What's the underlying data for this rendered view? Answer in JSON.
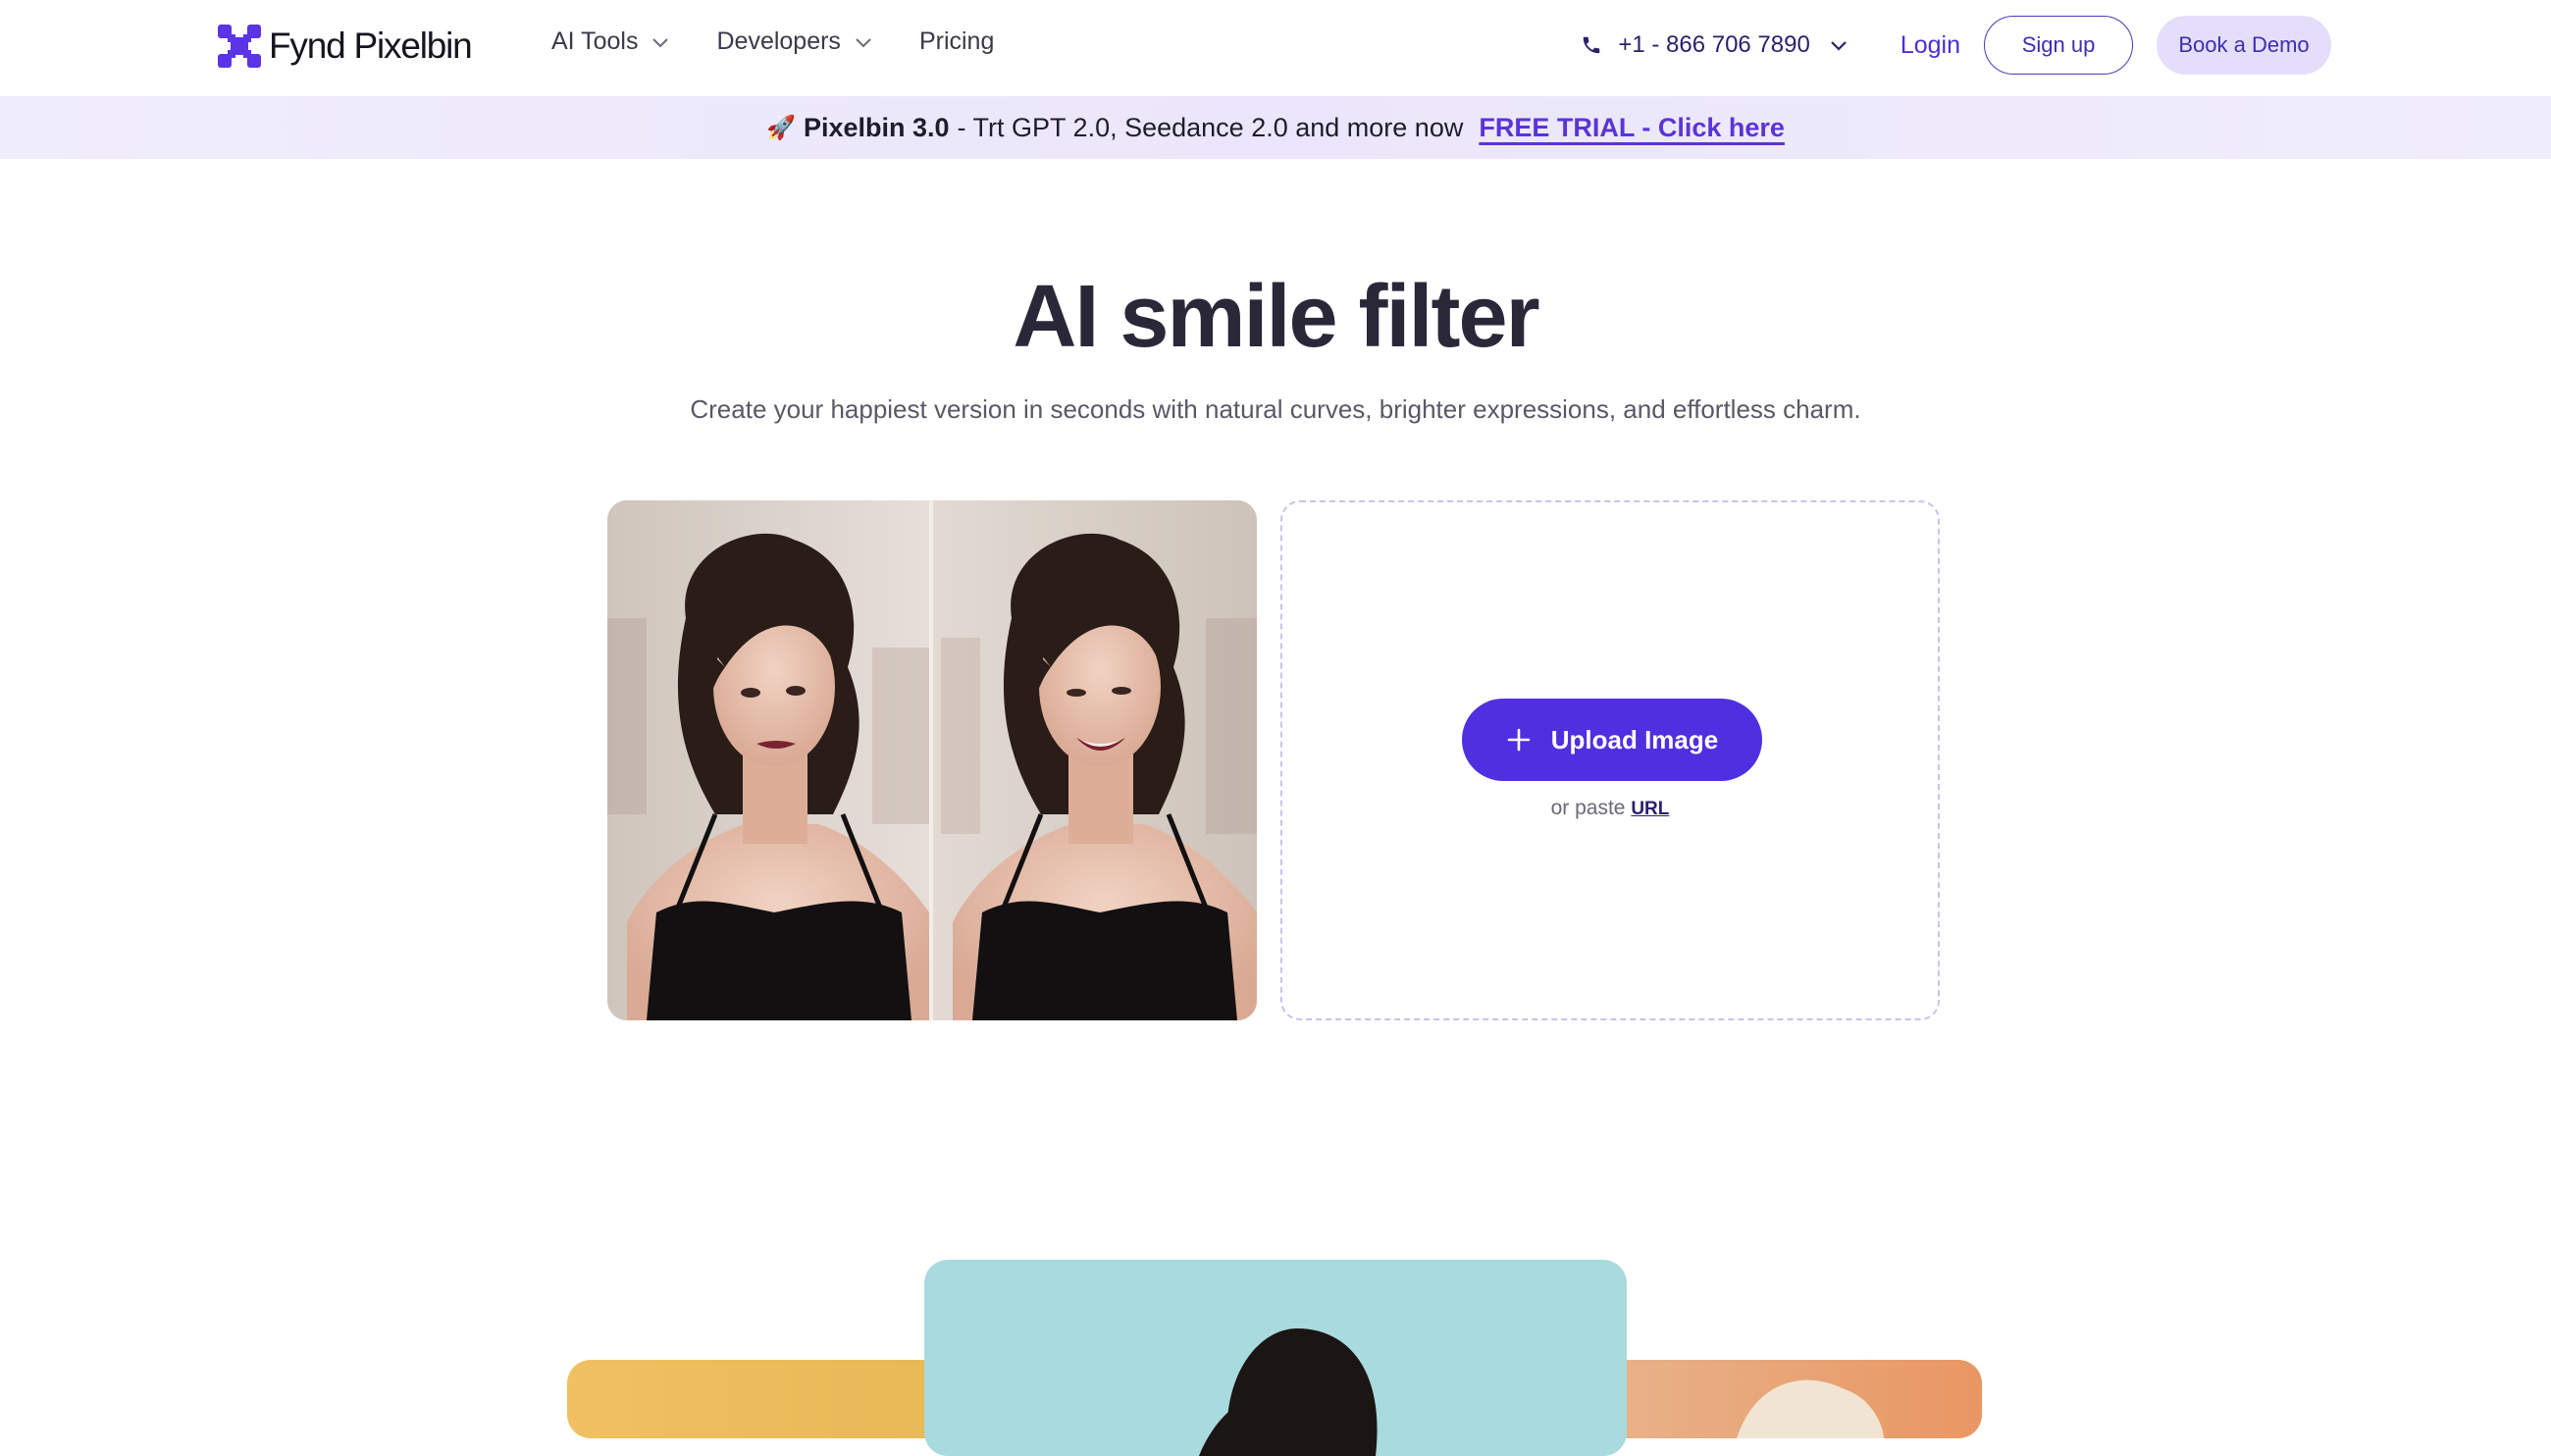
{
  "brand": {
    "name": "Fynd Pixelbin",
    "accent": "#4f2fe0",
    "logo_color": "#5b34e6"
  },
  "nav": {
    "items": [
      {
        "label": "AI Tools",
        "has_dropdown": true
      },
      {
        "label": "Developers",
        "has_dropdown": true
      },
      {
        "label": "Pricing",
        "has_dropdown": false
      }
    ],
    "phone": "+1 - 866 706 7890",
    "login": "Login",
    "signup": "Sign up",
    "demo": "Book a Demo"
  },
  "banner": {
    "icon": "rocket-icon",
    "highlight": "Pixelbin 3.0",
    "text": "- Trt GPT 2.0, Seedance 2.0 and more now",
    "cta": "FREE TRIAL - Click here"
  },
  "hero": {
    "title": "AI smile filter",
    "subtitle": "Create your happiest version in seconds with natural curves, brighter expressions, and effortless charm."
  },
  "upload": {
    "button_label": "Upload Image",
    "paste_prefix": "or paste",
    "url_label": "URL"
  }
}
